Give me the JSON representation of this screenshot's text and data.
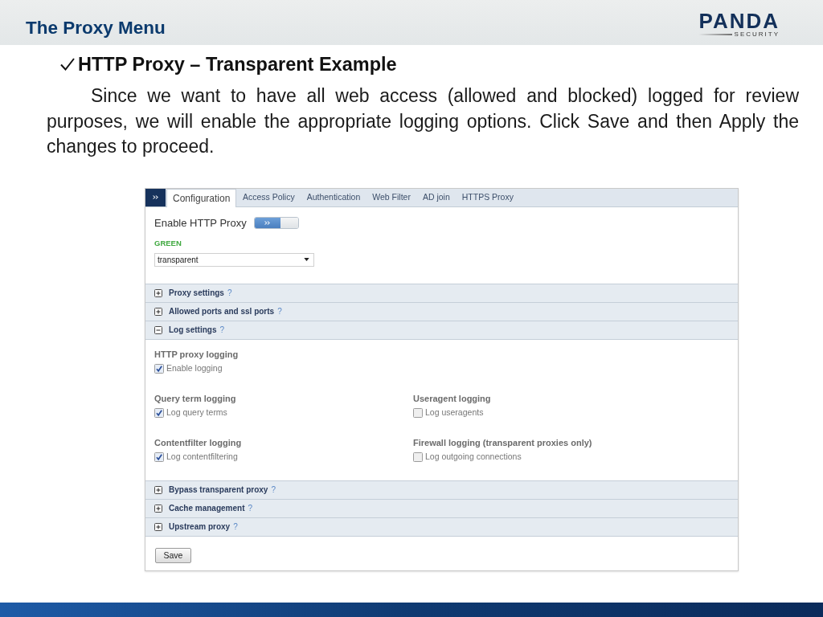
{
  "header": {
    "title": "The Proxy Menu",
    "logo": {
      "wordmark": "PANDA",
      "tagline": "SECURITY"
    }
  },
  "heading": "HTTP Proxy – Transparent Example",
  "paragraph": "Since we want to have all web access (allowed and blocked) logged for review purposes, we will enable the appropriate logging options. Click Save and then Apply the changes to proceed.",
  "screenshot": {
    "tabs": [
      {
        "label": "Configuration",
        "selected": true
      },
      {
        "label": "Access Policy",
        "selected": false
      },
      {
        "label": "Authentication",
        "selected": false
      },
      {
        "label": "Web Filter",
        "selected": false
      },
      {
        "label": "AD join",
        "selected": false
      },
      {
        "label": "HTTPS Proxy",
        "selected": false
      }
    ],
    "enable_label": "Enable HTTP Proxy",
    "toggle": {
      "on": true
    },
    "zone_label": "GREEN",
    "mode_select": {
      "value": "transparent"
    },
    "sections": [
      {
        "title": "Proxy settings",
        "help": "?",
        "expanded": false
      },
      {
        "title": "Allowed ports and ssl ports",
        "help": "?",
        "expanded": false
      },
      {
        "title": "Log settings",
        "help": "?",
        "expanded": true,
        "rows": [
          [
            {
              "label": "HTTP proxy logging",
              "option": {
                "label": "Enable logging",
                "checked": true
              }
            }
          ],
          [
            {
              "label": "Query term logging",
              "option": {
                "label": "Log query terms",
                "checked": true
              }
            },
            {
              "label": "Useragent logging",
              "option": {
                "label": "Log useragents",
                "checked": false
              }
            }
          ],
          [
            {
              "label": "Contentfilter logging",
              "option": {
                "label": "Log contentfiltering",
                "checked": true
              }
            },
            {
              "label": "Firewall logging (transparent proxies only)",
              "option": {
                "label": "Log outgoing connections",
                "checked": false
              }
            }
          ]
        ]
      },
      {
        "title": "Bypass transparent proxy",
        "help": "?",
        "expanded": false
      },
      {
        "title": "Cache management",
        "help": "?",
        "expanded": false
      },
      {
        "title": "Upstream proxy",
        "help": "?",
        "expanded": false
      }
    ],
    "save_button": "Save"
  }
}
